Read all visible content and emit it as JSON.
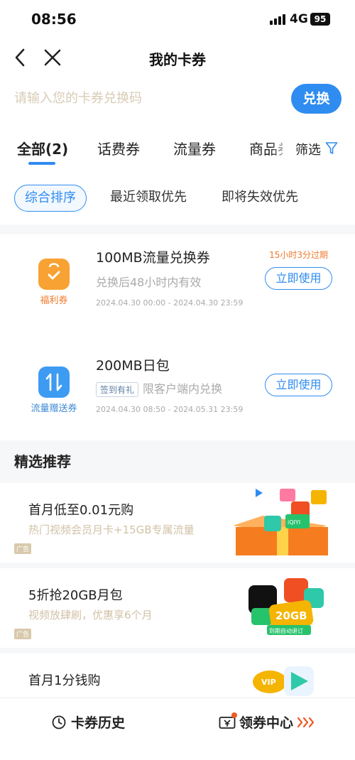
{
  "status_bar": {
    "time": "08:56",
    "network": "4G",
    "battery": "95"
  },
  "nav": {
    "title": "我的卡券"
  },
  "search": {
    "placeholder": "请输入您的卡券兑换码",
    "button_label": "兑换"
  },
  "tabs": [
    {
      "label": "全部(2)",
      "active": true
    },
    {
      "label": "话费券"
    },
    {
      "label": "流量券"
    },
    {
      "label": "商品券"
    }
  ],
  "filter": {
    "label": "筛选"
  },
  "sort_options": [
    {
      "label": "综合排序",
      "active": true
    },
    {
      "label": "最近领取优先"
    },
    {
      "label": "即将失效优先"
    }
  ],
  "coupons": [
    {
      "type_label": "福利券",
      "title": "100MB流量兑换券",
      "description": "兑换后48小时内有效",
      "date_range": "2024.04.30 00:00 - 2024.04.30 23:59",
      "expire_note": "15小时3分过期",
      "action": "立即使用",
      "icon": "gift-bag-icon",
      "icon_color": "#f7a233"
    },
    {
      "type_label": "流量赠送券",
      "title": "200MB日包",
      "tag": "签到有礼",
      "description": "限客户端内兑换",
      "date_range": "2024.04.30 08:50 - 2024.05.31 23:59",
      "action": "立即使用",
      "icon": "data-transfer-icon",
      "icon_color": "#3d9bf2"
    }
  ],
  "recommend": {
    "section_title": "精选推荐",
    "items": [
      {
        "title": "首月低至0.01元购",
        "subtitle": "热门视频会员月卡+15GB专属流量",
        "ad_label": "广告"
      },
      {
        "title": "5折抢20GB月包",
        "subtitle": "视频放肆刷，优惠享6个月",
        "ad_label": "广告",
        "art_text_1": "20GB",
        "art_text_2": "到期自动退订"
      },
      {
        "title": "首月1分钱购",
        "art_text_1": "VIP"
      }
    ]
  },
  "bottom_bar": {
    "history_label": "卡券历史",
    "center_label": "领券中心"
  },
  "colors": {
    "accent": "#2f8cf0",
    "warning": "#f07a2c",
    "gold": "#d2c2a7"
  }
}
